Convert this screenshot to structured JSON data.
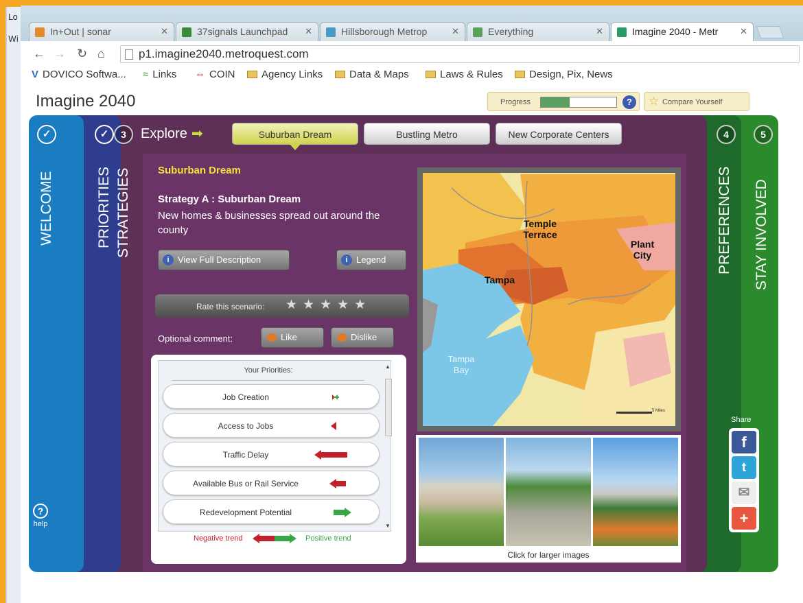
{
  "side_tab_bits": [
    "Lo",
    "Wi"
  ],
  "browser": {
    "tabs": [
      {
        "label": "In+Out | sonar",
        "active": false
      },
      {
        "label": "37signals Launchpad",
        "active": false
      },
      {
        "label": "Hillsborough Metrop",
        "active": false
      },
      {
        "label": "Everything",
        "active": false
      },
      {
        "label": "Imagine 2040 - Metr",
        "active": true
      }
    ],
    "url": "p1.imagine2040.metroquest.com",
    "bookmarks": [
      "DOVICO Softwa...",
      "Links",
      "COIN",
      "Agency Links",
      "Data & Maps",
      "Laws & Rules",
      "Design, Pix, News"
    ]
  },
  "app": {
    "title": "Imagine 2040",
    "progress_label": "Progress",
    "progress_value": 0.38,
    "compare_label": "Compare Yourself",
    "help_label": "help",
    "panels": {
      "welcome": "WELCOME",
      "priorities": "PRIORITIES",
      "strategies": "STRATEGIES",
      "strategies_num": "3",
      "preferences": "PREFERENCES",
      "preferences_num": "4",
      "stay_involved": "STAY INVOLVED",
      "stay_involved_num": "5"
    },
    "explore_label": "Explore",
    "scenario_tabs": [
      "Suburban Dream",
      "Bustling Metro",
      "New Corporate Centers"
    ],
    "scenario": {
      "heading": "Suburban Dream",
      "strategy_title": "Strategy A : Suburban Dream",
      "description": "New homes & businesses spread out around the county",
      "view_full_btn": "View Full Description",
      "legend_btn": "Legend",
      "rate_label": "Rate this scenario:",
      "rating_max": 5,
      "optional_comment": "Optional comment:",
      "like": "Like",
      "dislike": "Dislike"
    },
    "priorities": {
      "header": "Your Priorities:",
      "items": [
        {
          "label": "Job Creation",
          "trend": "mixed"
        },
        {
          "label": "Access to Jobs",
          "trend": "negative-small"
        },
        {
          "label": "Traffic Delay",
          "trend": "negative-large"
        },
        {
          "label": "Available Bus or Rail Service",
          "trend": "negative"
        },
        {
          "label": "Redevelopment Potential",
          "trend": "positive"
        }
      ],
      "negative_trend": "Negative trend",
      "positive_trend": "Positive trend"
    },
    "map": {
      "labels": [
        "Temple Terrace",
        "Plant City",
        "Tampa",
        "Tampa Bay"
      ],
      "scale_label": "5 Miles"
    },
    "images_caption": "Click for larger images",
    "share_label": "Share",
    "share_buttons": [
      "facebook",
      "twitter",
      "email",
      "more"
    ]
  },
  "colors": {
    "welcome": "#1a7cc1",
    "priorities": "#2f3d8f",
    "strategies": "#5e3058",
    "preferences": "#1e6a2a",
    "stay_involved": "#2a8a2c",
    "accent_yellow": "#f3e23a"
  }
}
